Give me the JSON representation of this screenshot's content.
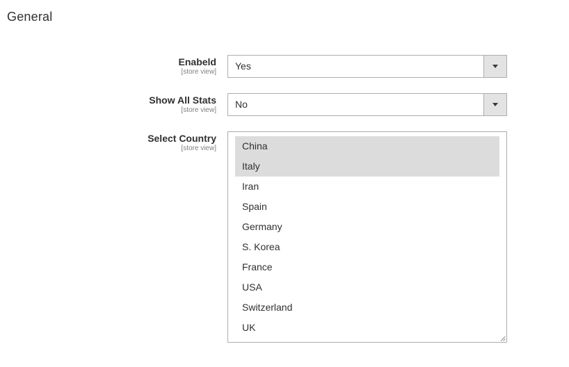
{
  "section": {
    "title": "General"
  },
  "fields": {
    "enabled": {
      "label": "Enabeld",
      "scope": "[store view]",
      "value": "Yes"
    },
    "show_all_stats": {
      "label": "Show All Stats",
      "scope": "[store view]",
      "value": "No"
    },
    "select_country": {
      "label": "Select Country",
      "scope": "[store view]",
      "options": [
        {
          "label": "China",
          "selected": true
        },
        {
          "label": "Italy",
          "selected": true
        },
        {
          "label": "Iran",
          "selected": false
        },
        {
          "label": "Spain",
          "selected": false
        },
        {
          "label": "Germany",
          "selected": false
        },
        {
          "label": "S. Korea",
          "selected": false
        },
        {
          "label": "France",
          "selected": false
        },
        {
          "label": "USA",
          "selected": false
        },
        {
          "label": "Switzerland",
          "selected": false
        },
        {
          "label": "UK",
          "selected": false
        }
      ]
    }
  },
  "colors": {
    "selected_option_bg": "#dcdcdc",
    "border": "#adadad",
    "arrow_button_bg": "#e3e3e3",
    "text": "#303030",
    "scope_text": "#808080"
  }
}
